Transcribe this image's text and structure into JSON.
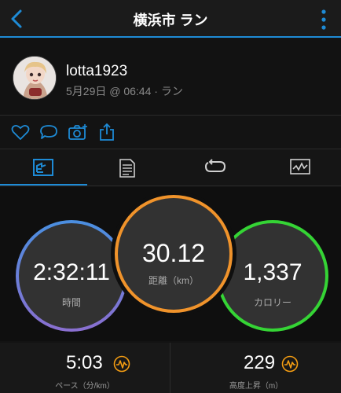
{
  "header": {
    "title": "横浜市 ラン"
  },
  "profile": {
    "username": "lotta1923",
    "meta": "5月29日 @ 06:44 · ラン"
  },
  "social_icons": [
    "heart-icon",
    "comment-icon",
    "camera-add-icon",
    "share-icon"
  ],
  "tabs": [
    {
      "name": "stats-tab-icon",
      "active": true
    },
    {
      "name": "details-tab-icon",
      "active": false
    },
    {
      "name": "laps-tab-icon",
      "active": false
    },
    {
      "name": "charts-tab-icon",
      "active": false
    }
  ],
  "circles": {
    "time": {
      "value": "2:32:11",
      "label": "時間"
    },
    "distance": {
      "value": "30.12",
      "label": "距離（km）"
    },
    "calories": {
      "value": "1,337",
      "label": "カロリー"
    }
  },
  "stats": {
    "pace": {
      "value": "5:03",
      "label": "ペース（分/km）"
    },
    "elevation": {
      "value": "229",
      "label": "高度上昇（m）"
    }
  },
  "colors": {
    "accent": "#1e8bd6",
    "time_ring": "#4a8fe0",
    "distance_ring": "#f0932b",
    "calories_ring": "#35d435",
    "trend_icon": "#f39c12"
  }
}
